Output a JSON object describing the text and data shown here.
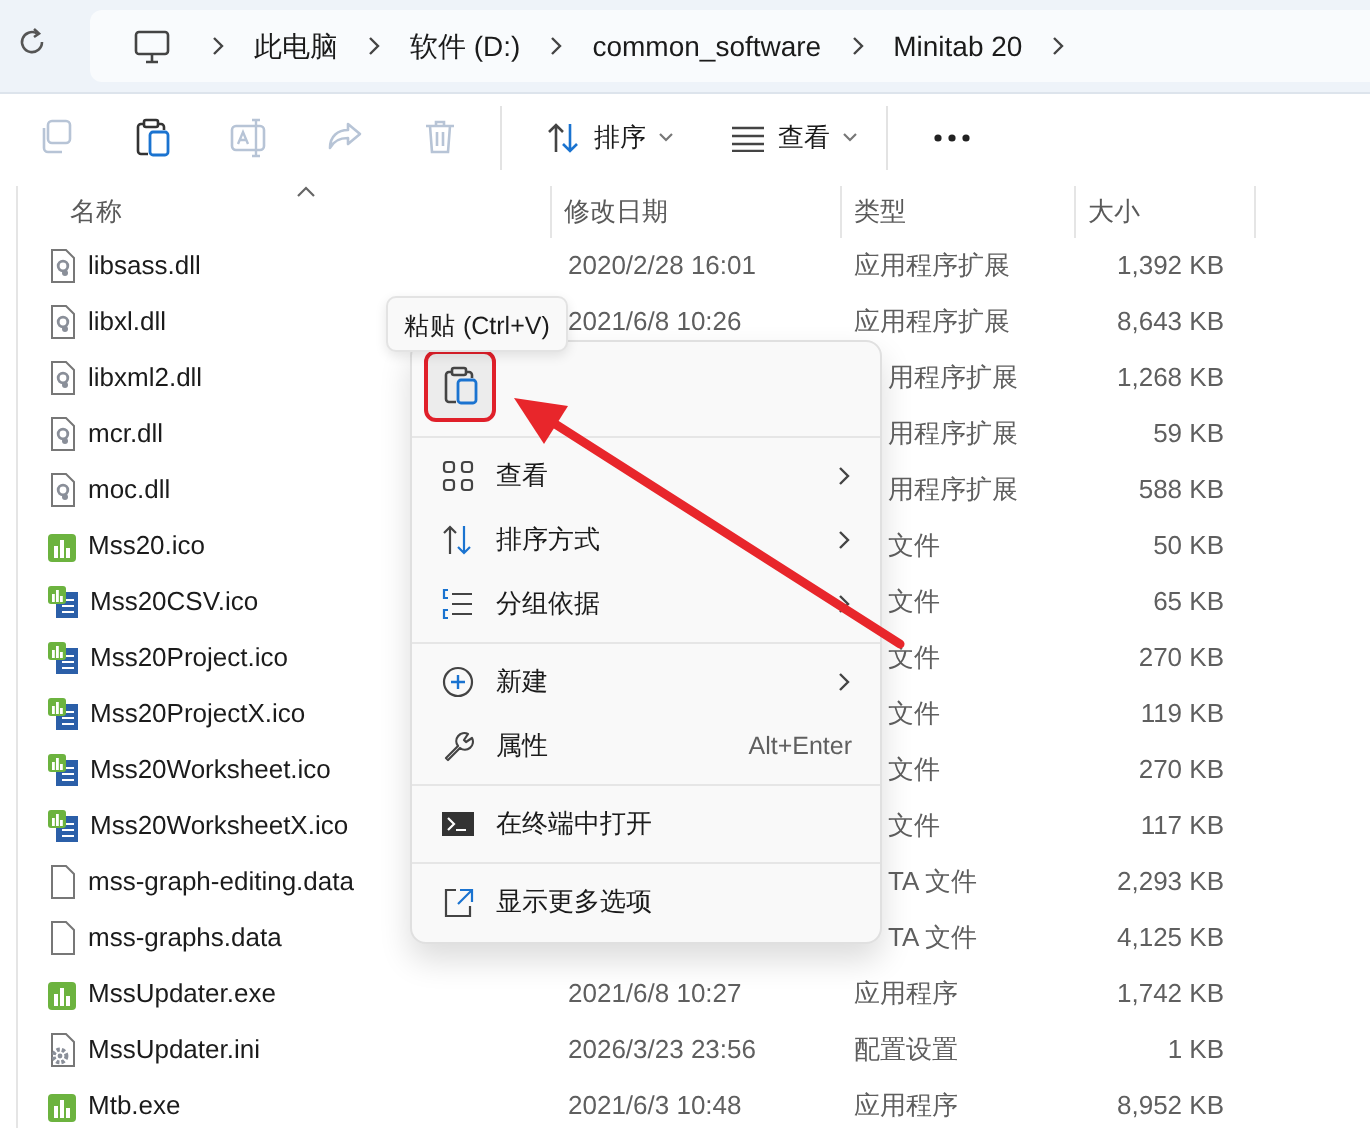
{
  "address_bar": {
    "crumbs": [
      "此电脑",
      "软件 (D:)",
      "common_software",
      "Minitab 20"
    ]
  },
  "toolbar": {
    "actions": [
      {
        "kind": "copy",
        "disabled": true
      },
      {
        "kind": "paste",
        "disabled": false
      },
      {
        "kind": "rename",
        "disabled": true
      },
      {
        "kind": "share",
        "disabled": true
      },
      {
        "kind": "delete",
        "disabled": true
      }
    ],
    "sort": {
      "label": "排序"
    },
    "view": {
      "label": "查看"
    }
  },
  "columns": [
    {
      "label": "名称",
      "sorted": true
    },
    {
      "label": "修改日期",
      "sorted": false
    },
    {
      "label": "类型",
      "sorted": false
    },
    {
      "label": "大小",
      "sorted": false
    }
  ],
  "files": [
    {
      "name": "libsass.dll",
      "kind": "dll",
      "modified": "2020/2/28 16:01",
      "type": "应用程序扩展",
      "size": "1,392 KB"
    },
    {
      "name": "libxl.dll",
      "kind": "dll",
      "modified": "2021/6/8 10:26",
      "type": "应用程序扩展",
      "size": "8,643 KB"
    },
    {
      "name": "libxml2.dll",
      "kind": "dll",
      "type": "用程序扩展",
      "size": "1,268 KB"
    },
    {
      "name": "mcr.dll",
      "kind": "dll",
      "type": "用程序扩展",
      "size": "59 KB"
    },
    {
      "name": "moc.dll",
      "kind": "dll",
      "type": "用程序扩展",
      "size": "588 KB"
    },
    {
      "name": "Mss20.ico",
      "kind": "chart",
      "type": "文件",
      "size": "50 KB"
    },
    {
      "name": "Mss20CSV.ico",
      "kind": "chart-doc",
      "type": "文件",
      "size": "65 KB"
    },
    {
      "name": "Mss20Project.ico",
      "kind": "chart-doc",
      "type": "文件",
      "size": "270 KB"
    },
    {
      "name": "Mss20ProjectX.ico",
      "kind": "chart-doc",
      "type": "文件",
      "size": "119 KB"
    },
    {
      "name": "Mss20Worksheet.ico",
      "kind": "chart-doc",
      "type": "文件",
      "size": "270 KB"
    },
    {
      "name": "Mss20WorksheetX.ico",
      "kind": "chart-doc",
      "type": "文件",
      "size": "117 KB"
    },
    {
      "name": "mss-graph-editing.data",
      "kind": "blank",
      "type": "TA 文件",
      "size": "2,293 KB"
    },
    {
      "name": "mss-graphs.data",
      "kind": "blank",
      "type": "TA 文件",
      "size": "4,125 KB"
    },
    {
      "name": "MssUpdater.exe",
      "kind": "chart",
      "modified": "2021/6/8 10:27",
      "type": "应用程序",
      "size": "1,742 KB"
    },
    {
      "name": "MssUpdater.ini",
      "kind": "settings",
      "modified": "2026/3/23 23:56",
      "type": "配置设置",
      "size": "1 KB"
    },
    {
      "name": "Mtb.exe",
      "kind": "chart",
      "modified": "2021/6/3 10:48",
      "type": "应用程序",
      "size": "8,952 KB"
    }
  ],
  "context_menu": {
    "tooltip": "粘贴 (Ctrl+V)",
    "quick_actions": [
      {
        "kind": "paste",
        "highlighted": true
      }
    ],
    "groups": [
      [
        {
          "kind": "view",
          "label": "查看",
          "submenu": true
        },
        {
          "kind": "sort",
          "label": "排序方式",
          "submenu": true
        },
        {
          "kind": "group",
          "label": "分组依据",
          "submenu": true
        }
      ],
      [
        {
          "kind": "new",
          "label": "新建",
          "submenu": true
        },
        {
          "kind": "properties",
          "label": "属性",
          "shortcut": "Alt+Enter",
          "submenu": false
        }
      ],
      [
        {
          "kind": "terminal",
          "label": "在终端中打开",
          "submenu": false
        }
      ],
      [
        {
          "kind": "more",
          "label": "显示更多选项",
          "submenu": false
        }
      ]
    ]
  }
}
